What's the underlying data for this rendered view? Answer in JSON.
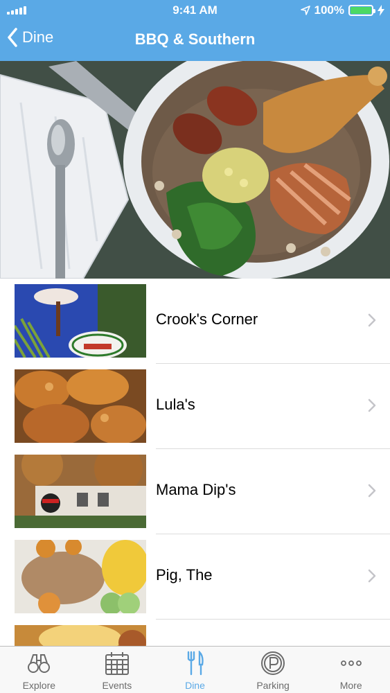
{
  "status_bar": {
    "time": "9:41 AM",
    "battery": "100%"
  },
  "nav": {
    "back_label": "Dine",
    "title": "BBQ & Southern"
  },
  "hero": {
    "image": "bowl of beans, greens, sausage and duck"
  },
  "restaurants": [
    {
      "name": "Crook's Corner",
      "thumb": "restaurant sign with pig"
    },
    {
      "name": "Lula's",
      "thumb": "fried chicken"
    },
    {
      "name": "Mama Dip's",
      "thumb": "restaurant building exterior"
    },
    {
      "name": "Pig, The",
      "thumb": "pulled pork plate"
    },
    {
      "name": "",
      "thumb": "partially visible food plate"
    }
  ],
  "tabs": [
    {
      "label": "Explore",
      "icon": "binoculars-icon",
      "active": false
    },
    {
      "label": "Events",
      "icon": "calendar-icon",
      "active": false
    },
    {
      "label": "Dine",
      "icon": "fork-knife-icon",
      "active": true
    },
    {
      "label": "Parking",
      "icon": "parking-icon",
      "active": false
    },
    {
      "label": "More",
      "icon": "more-dots-icon",
      "active": false
    }
  ],
  "colors": {
    "accent": "#5aa9e6",
    "battery": "#4cd964"
  }
}
